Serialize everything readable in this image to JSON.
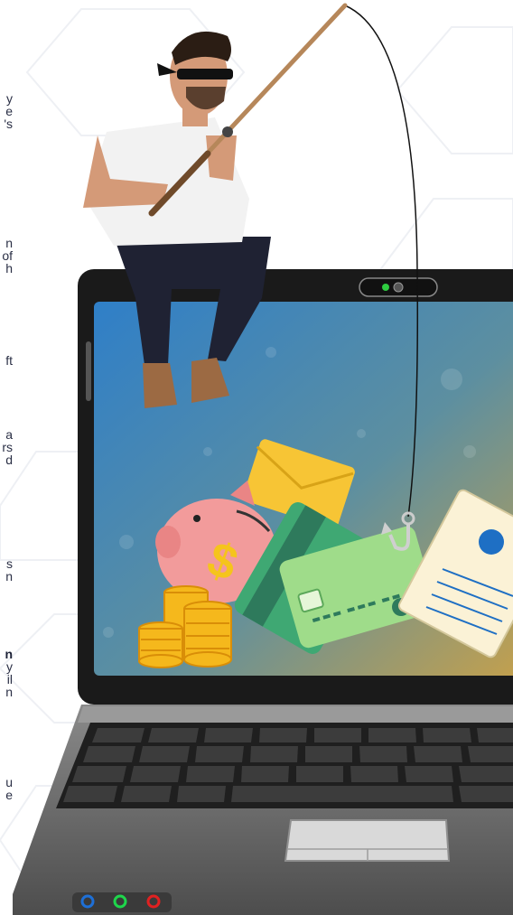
{
  "text_fragments": [
    {
      "id": "l1",
      "text": "y"
    },
    {
      "id": "l2",
      "text": "e"
    },
    {
      "id": "l3",
      "text": "'s"
    },
    {
      "id": "l4",
      "text": "n"
    },
    {
      "id": "l5",
      "text": "of"
    },
    {
      "id": "l6",
      "text": "h"
    },
    {
      "id": "l7",
      "text": "ft"
    },
    {
      "id": "l8",
      "text": "a"
    },
    {
      "id": "l9",
      "text": "rs"
    },
    {
      "id": "l10",
      "text": "d"
    },
    {
      "id": "l11",
      "text": "s"
    },
    {
      "id": "l12",
      "text": "n"
    },
    {
      "id": "l13",
      "text": "n"
    },
    {
      "id": "l14",
      "text": "y"
    },
    {
      "id": "l15",
      "text": "il"
    },
    {
      "id": "l16",
      "text": "n"
    },
    {
      "id": "l17",
      "text": "u"
    },
    {
      "id": "l18",
      "text": "e"
    }
  ],
  "illustration": {
    "subject": "hacker-fishing-from-laptop",
    "colors": {
      "screen_top": "#2f7fc8",
      "screen_bottom": "#c2a04e",
      "envelope": "#f7c535",
      "piggy_bank": "#f29b9b",
      "dollar": "#f5c41c",
      "card_dark": "#2e7a5c",
      "card_light": "#9fdc8a",
      "document": "#fbf2d6",
      "seal": "#1e6fc4",
      "laptop_body": "#6b6b6b",
      "keyboard": "#3a3a3a"
    },
    "icons": [
      "envelope-icon",
      "piggy-bank-icon",
      "credit-card-icon",
      "document-icon",
      "coin-stack-icon",
      "fishing-hook-icon",
      "webcam-icon",
      "port-icon"
    ]
  }
}
